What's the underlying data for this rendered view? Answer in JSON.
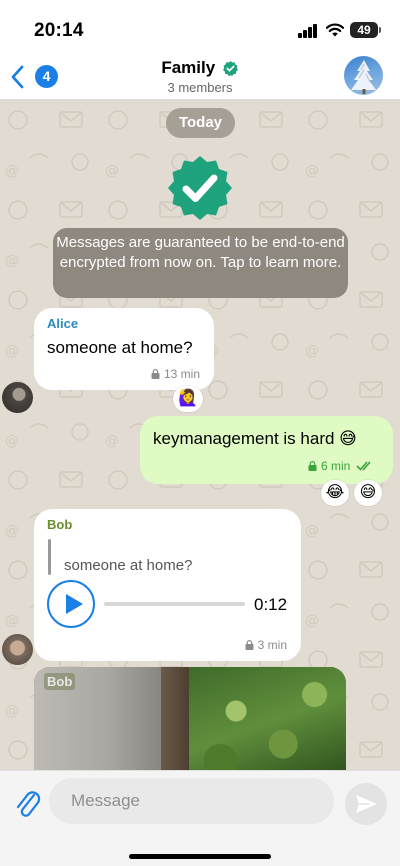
{
  "status_bar": {
    "time": "20:14",
    "battery": "49"
  },
  "header": {
    "back_badge": "4",
    "title": "Family",
    "subtitle": "3 members"
  },
  "chat": {
    "date_label": "Today",
    "encryption_notice": "Messages are guaranteed to be end-to-end encrypted from now on. Tap to learn more.",
    "messages": [
      {
        "sender": "Alice",
        "text": "someone at home?",
        "time": "13 min",
        "reaction": "🙋‍♀️",
        "direction": "incoming"
      },
      {
        "text": "keymanagement is hard 😅",
        "time": "6 min",
        "reactions": [
          "😂",
          "😅"
        ],
        "direction": "outgoing"
      },
      {
        "sender": "Bob",
        "quote": "someone at home?",
        "audio_duration": "0:12",
        "time": "3 min",
        "direction": "incoming"
      },
      {
        "sender": "Bob",
        "type": "image",
        "direction": "incoming"
      }
    ]
  },
  "input": {
    "placeholder": "Message"
  },
  "colors": {
    "accent": "#1a7fe6",
    "verified": "#1fa37e",
    "alice_name": "#2e8ab8",
    "bob_name": "#6a8e2e",
    "outgoing_bubble": "#e0fac4",
    "chat_bg": "#e2dbd1"
  },
  "icons": {
    "back": "chevron-left-icon",
    "verified": "verified-check-icon",
    "attach": "paperclip-icon",
    "send": "send-icon",
    "lock": "lock-icon"
  }
}
